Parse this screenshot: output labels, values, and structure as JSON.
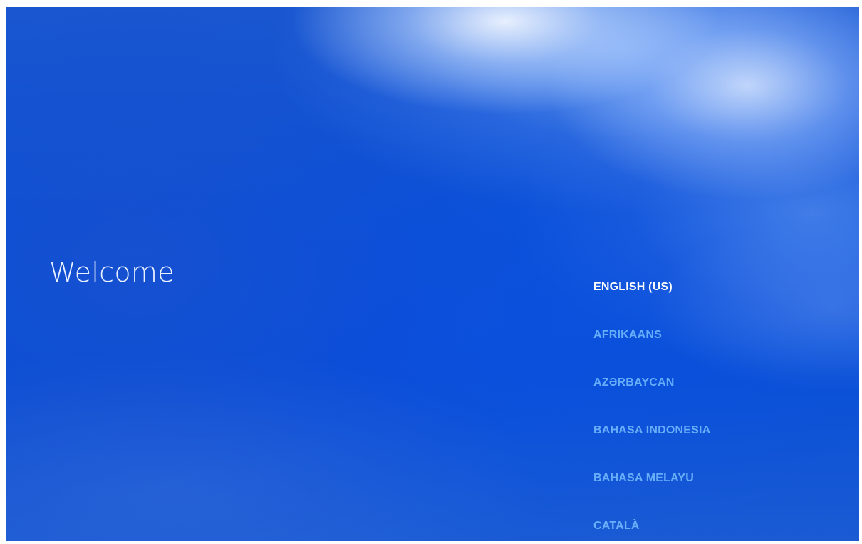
{
  "welcome": {
    "title": "Welcome"
  },
  "languages": {
    "selected_index": 0,
    "items": [
      {
        "label": "ENGLISH (US)"
      },
      {
        "label": "AFRIKAANS"
      },
      {
        "label": "AZƏRBAYCAN"
      },
      {
        "label": "BAHASA INDONESIA"
      },
      {
        "label": "BAHASA MELAYU"
      },
      {
        "label": "CATALÀ"
      }
    ]
  },
  "colors": {
    "background": "#0b4fd6",
    "title_text": "#eaf2ff",
    "selected_item": "#ffffff",
    "unselected_item": "#78beff"
  }
}
